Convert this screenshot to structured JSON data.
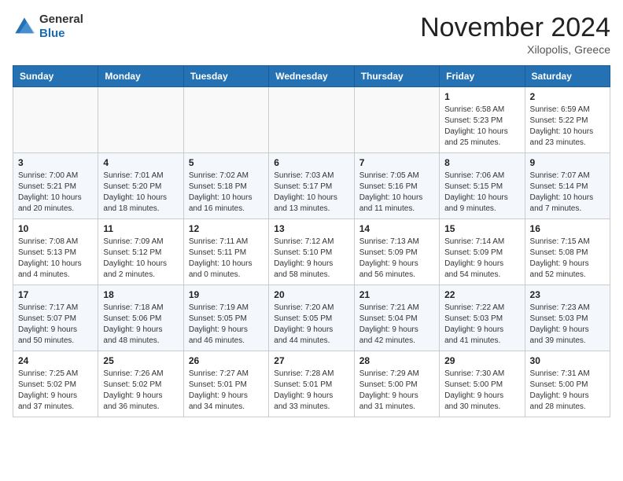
{
  "header": {
    "logo_line1": "General",
    "logo_line2": "Blue",
    "month": "November 2024",
    "location": "Xilopolis, Greece"
  },
  "weekdays": [
    "Sunday",
    "Monday",
    "Tuesday",
    "Wednesday",
    "Thursday",
    "Friday",
    "Saturday"
  ],
  "weeks": [
    [
      {
        "day": "",
        "info": ""
      },
      {
        "day": "",
        "info": ""
      },
      {
        "day": "",
        "info": ""
      },
      {
        "day": "",
        "info": ""
      },
      {
        "day": "",
        "info": ""
      },
      {
        "day": "1",
        "info": "Sunrise: 6:58 AM\nSunset: 5:23 PM\nDaylight: 10 hours\nand 25 minutes."
      },
      {
        "day": "2",
        "info": "Sunrise: 6:59 AM\nSunset: 5:22 PM\nDaylight: 10 hours\nand 23 minutes."
      }
    ],
    [
      {
        "day": "3",
        "info": "Sunrise: 7:00 AM\nSunset: 5:21 PM\nDaylight: 10 hours\nand 20 minutes."
      },
      {
        "day": "4",
        "info": "Sunrise: 7:01 AM\nSunset: 5:20 PM\nDaylight: 10 hours\nand 18 minutes."
      },
      {
        "day": "5",
        "info": "Sunrise: 7:02 AM\nSunset: 5:18 PM\nDaylight: 10 hours\nand 16 minutes."
      },
      {
        "day": "6",
        "info": "Sunrise: 7:03 AM\nSunset: 5:17 PM\nDaylight: 10 hours\nand 13 minutes."
      },
      {
        "day": "7",
        "info": "Sunrise: 7:05 AM\nSunset: 5:16 PM\nDaylight: 10 hours\nand 11 minutes."
      },
      {
        "day": "8",
        "info": "Sunrise: 7:06 AM\nSunset: 5:15 PM\nDaylight: 10 hours\nand 9 minutes."
      },
      {
        "day": "9",
        "info": "Sunrise: 7:07 AM\nSunset: 5:14 PM\nDaylight: 10 hours\nand 7 minutes."
      }
    ],
    [
      {
        "day": "10",
        "info": "Sunrise: 7:08 AM\nSunset: 5:13 PM\nDaylight: 10 hours\nand 4 minutes."
      },
      {
        "day": "11",
        "info": "Sunrise: 7:09 AM\nSunset: 5:12 PM\nDaylight: 10 hours\nand 2 minutes."
      },
      {
        "day": "12",
        "info": "Sunrise: 7:11 AM\nSunset: 5:11 PM\nDaylight: 10 hours\nand 0 minutes."
      },
      {
        "day": "13",
        "info": "Sunrise: 7:12 AM\nSunset: 5:10 PM\nDaylight: 9 hours\nand 58 minutes."
      },
      {
        "day": "14",
        "info": "Sunrise: 7:13 AM\nSunset: 5:09 PM\nDaylight: 9 hours\nand 56 minutes."
      },
      {
        "day": "15",
        "info": "Sunrise: 7:14 AM\nSunset: 5:09 PM\nDaylight: 9 hours\nand 54 minutes."
      },
      {
        "day": "16",
        "info": "Sunrise: 7:15 AM\nSunset: 5:08 PM\nDaylight: 9 hours\nand 52 minutes."
      }
    ],
    [
      {
        "day": "17",
        "info": "Sunrise: 7:17 AM\nSunset: 5:07 PM\nDaylight: 9 hours\nand 50 minutes."
      },
      {
        "day": "18",
        "info": "Sunrise: 7:18 AM\nSunset: 5:06 PM\nDaylight: 9 hours\nand 48 minutes."
      },
      {
        "day": "19",
        "info": "Sunrise: 7:19 AM\nSunset: 5:05 PM\nDaylight: 9 hours\nand 46 minutes."
      },
      {
        "day": "20",
        "info": "Sunrise: 7:20 AM\nSunset: 5:05 PM\nDaylight: 9 hours\nand 44 minutes."
      },
      {
        "day": "21",
        "info": "Sunrise: 7:21 AM\nSunset: 5:04 PM\nDaylight: 9 hours\nand 42 minutes."
      },
      {
        "day": "22",
        "info": "Sunrise: 7:22 AM\nSunset: 5:03 PM\nDaylight: 9 hours\nand 41 minutes."
      },
      {
        "day": "23",
        "info": "Sunrise: 7:23 AM\nSunset: 5:03 PM\nDaylight: 9 hours\nand 39 minutes."
      }
    ],
    [
      {
        "day": "24",
        "info": "Sunrise: 7:25 AM\nSunset: 5:02 PM\nDaylight: 9 hours\nand 37 minutes."
      },
      {
        "day": "25",
        "info": "Sunrise: 7:26 AM\nSunset: 5:02 PM\nDaylight: 9 hours\nand 36 minutes."
      },
      {
        "day": "26",
        "info": "Sunrise: 7:27 AM\nSunset: 5:01 PM\nDaylight: 9 hours\nand 34 minutes."
      },
      {
        "day": "27",
        "info": "Sunrise: 7:28 AM\nSunset: 5:01 PM\nDaylight: 9 hours\nand 33 minutes."
      },
      {
        "day": "28",
        "info": "Sunrise: 7:29 AM\nSunset: 5:00 PM\nDaylight: 9 hours\nand 31 minutes."
      },
      {
        "day": "29",
        "info": "Sunrise: 7:30 AM\nSunset: 5:00 PM\nDaylight: 9 hours\nand 30 minutes."
      },
      {
        "day": "30",
        "info": "Sunrise: 7:31 AM\nSunset: 5:00 PM\nDaylight: 9 hours\nand 28 minutes."
      }
    ]
  ]
}
